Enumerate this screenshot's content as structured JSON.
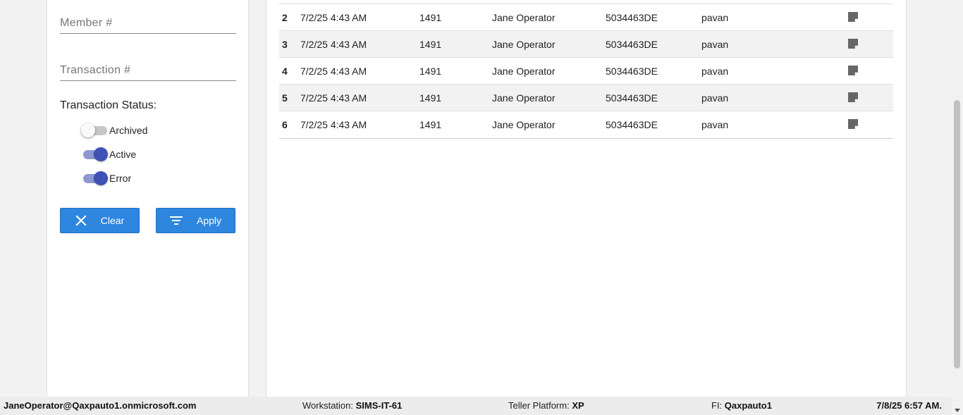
{
  "filters": {
    "member_placeholder": "Member #",
    "transaction_placeholder": "Transaction #",
    "status_label": "Transaction Status:",
    "statuses": [
      {
        "label": "Archived",
        "checked": false
      },
      {
        "label": "Active",
        "checked": true
      },
      {
        "label": "Error",
        "checked": true
      }
    ],
    "clear_label": "Clear",
    "apply_label": "Apply"
  },
  "table": {
    "rows": [
      {
        "index": "2",
        "date": "7/2/25 4:43 AM",
        "member": "1491",
        "operator": "Jane Operator",
        "workstation": "5034463DE",
        "user": "pavan"
      },
      {
        "index": "3",
        "date": "7/2/25 4:43 AM",
        "member": "1491",
        "operator": "Jane Operator",
        "workstation": "5034463DE",
        "user": "pavan"
      },
      {
        "index": "4",
        "date": "7/2/25 4:43 AM",
        "member": "1491",
        "operator": "Jane Operator",
        "workstation": "5034463DE",
        "user": "pavan"
      },
      {
        "index": "5",
        "date": "7/2/25 4:43 AM",
        "member": "1491",
        "operator": "Jane Operator",
        "workstation": "5034463DE",
        "user": "pavan"
      },
      {
        "index": "6",
        "date": "7/2/25 4:43 AM",
        "member": "1491",
        "operator": "Jane Operator",
        "workstation": "5034463DE",
        "user": "pavan"
      }
    ],
    "note_icon": "note-icon"
  },
  "footer": {
    "user": "JaneOperator@Qaxpauto1.onmicrosoft.com",
    "workstation_label": "Workstation:",
    "workstation_value": "SIMS-IT-61",
    "platform_label": "Teller Platform:",
    "platform_value": "XP",
    "fi_label": "FI:",
    "fi_value": "Qaxpauto1",
    "datetime": "7/8/25 6:57 AM."
  },
  "colors": {
    "button": "#2e86de",
    "toggle_on": "#3f51b5",
    "toggle_track_on": "#8f97d3"
  }
}
